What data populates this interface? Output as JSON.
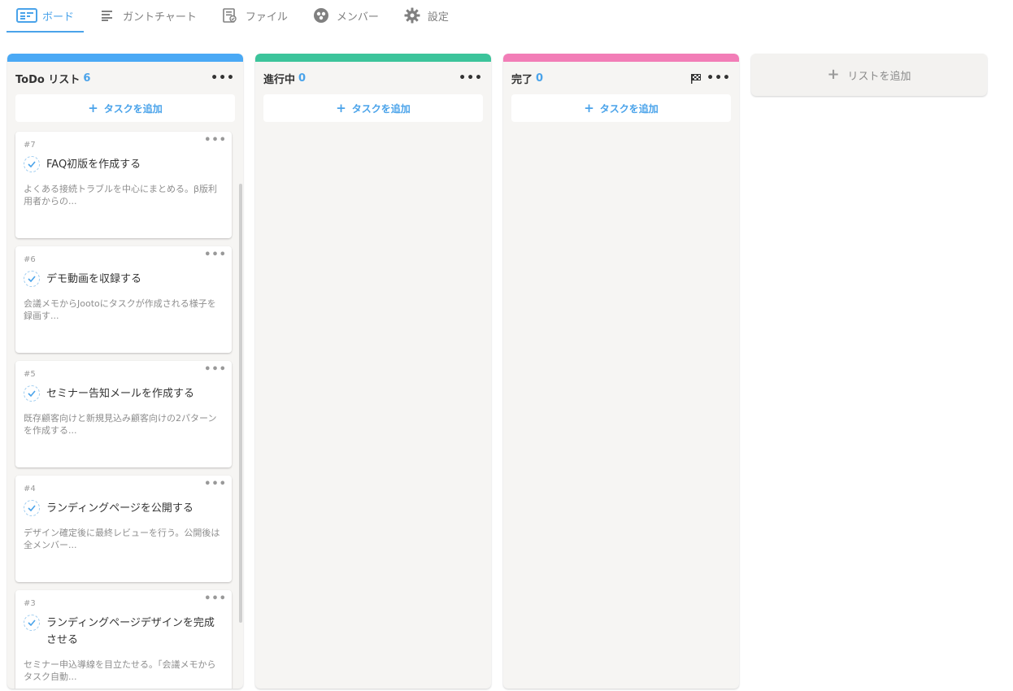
{
  "nav": {
    "tabs": [
      {
        "label": "ボード",
        "icon": "board-icon"
      },
      {
        "label": "ガントチャート",
        "icon": "gantt-icon"
      },
      {
        "label": "ファイル",
        "icon": "file-icon"
      },
      {
        "label": "メンバー",
        "icon": "members-icon"
      },
      {
        "label": "設定",
        "icon": "gear-icon"
      }
    ],
    "active_tab": "ボード"
  },
  "colors": {
    "accent": "#4aa3ea",
    "todo_bar": "#4aa9f5",
    "progress_bar": "#3cc49b",
    "done_bar": "#f27db7"
  },
  "lists": [
    {
      "title": "ToDo リスト",
      "count": "6",
      "add_task_label": "タスクを追加",
      "cards": [
        {
          "number": "#7",
          "title": "FAQ初版を作成する",
          "desc": "よくある接続トラブルを中心にまとめる。β版利用者からの..."
        },
        {
          "number": "#6",
          "title": "デモ動画を収録する",
          "desc": "会議メモからJootoにタスクが作成される様子を録画す..."
        },
        {
          "number": "#5",
          "title": "セミナー告知メールを作成する",
          "desc": "既存顧客向けと新規見込み顧客向けの2パターンを作成する..."
        },
        {
          "number": "#4",
          "title": "ランディングページを公開する",
          "desc": "デザイン確定後に最終レビューを行う。公開後は全メンバー..."
        },
        {
          "number": "#3",
          "title": "ランディングページデザインを完成させる",
          "desc": "セミナー申込導線を目立たせる。「会議メモからタスク自動..."
        }
      ]
    },
    {
      "title": "進行中",
      "count": "0",
      "add_task_label": "タスクを追加",
      "cards": []
    },
    {
      "title": "完了",
      "count": "0",
      "add_task_label": "タスクを追加",
      "cards": []
    }
  ],
  "add_list_label": "リストを追加"
}
